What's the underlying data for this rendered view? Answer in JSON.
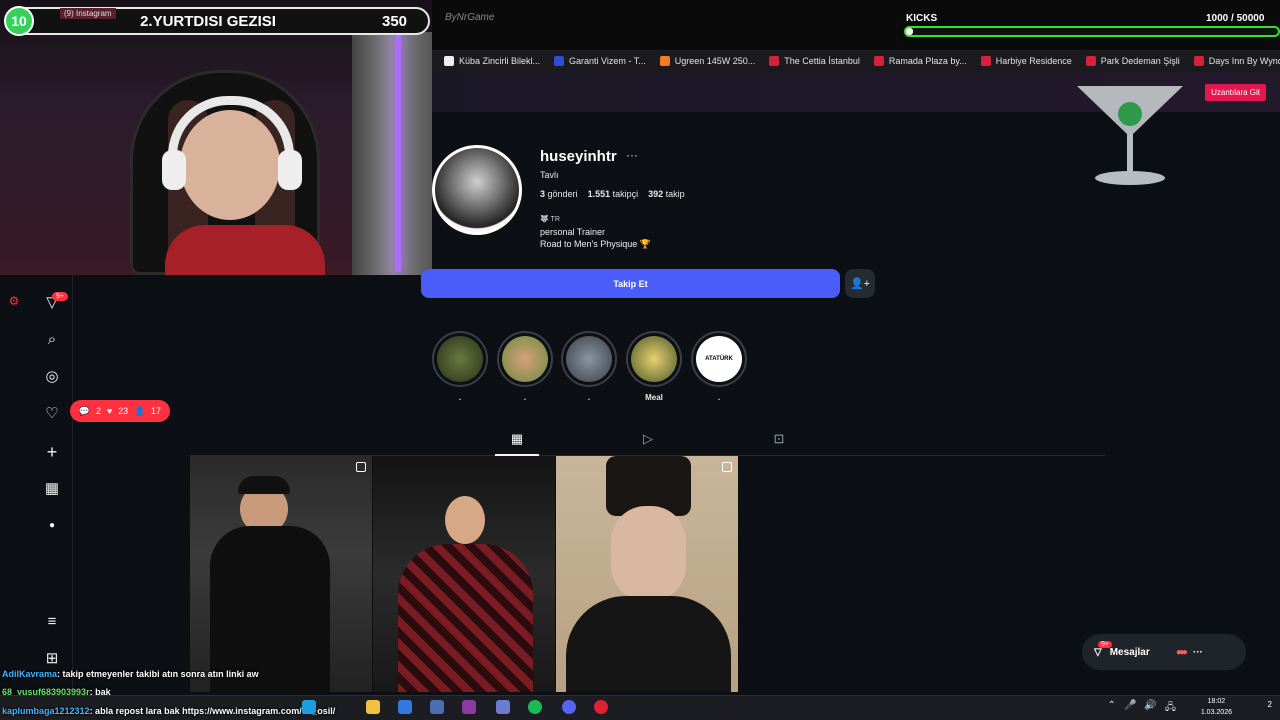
{
  "overlay": {
    "goal_count": "10",
    "goal_title": "2.YURTDISI GEZISI",
    "goal_value": "350",
    "tab_label": "(9) Instagram",
    "logo_mark": "ByNrGame",
    "kicks_title": "KICKS",
    "kicks_value": "1000  / 50000",
    "kicks_progress": 0.02
  },
  "bookmarks": [
    {
      "label": "Küba Zincirli Bilekl...",
      "color": "#f0f0f0"
    },
    {
      "label": "Garanti Vizem - T...",
      "color": "#2f4bd8"
    },
    {
      "label": "Ugreen 145W 250...",
      "color": "#f47b20"
    },
    {
      "label": "The Cettia İstanbul",
      "color": "#d6213a"
    },
    {
      "label": "Ramada Plaza by...",
      "color": "#d6213a"
    },
    {
      "label": "Harbiye Residence",
      "color": "#d6213a"
    },
    {
      "label": "Park Dedeman Şişli",
      "color": "#d6213a"
    },
    {
      "label": "Days Inn By Wynd...",
      "color": "#d6213a"
    }
  ],
  "extension_button": "Uzantılara Git",
  "sidebar": {
    "notif_badge": "9+",
    "activity": {
      "comments": "2",
      "likes": "23",
      "follows": "17"
    }
  },
  "profile": {
    "username": "huseyinhtr",
    "more": "···",
    "full_name": "Tavlı",
    "stats": {
      "posts_num": "3",
      "posts_label": "gönderi",
      "followers_num": "1.551",
      "followers_label": "takipçi",
      "following_num": "392",
      "following_label": "takip"
    },
    "bio_flag": "TR",
    "bio_line1": "personal Trainer",
    "bio_line2": "Road to Men's Physique 🏆",
    "follow_button": "Takip Et"
  },
  "highlights": [
    {
      "label": ".",
      "color": "#3a4a2a"
    },
    {
      "label": ".",
      "color": "#c58a5e"
    },
    {
      "label": ".",
      "color": "#5a6470"
    },
    {
      "label": "Meal",
      "color": "#8a7a40"
    },
    {
      "label": ".",
      "color": "#ffffff",
      "text": "ATATÜRK"
    }
  ],
  "messages": {
    "label": "Mesajlar",
    "badge": "9+"
  },
  "chat": [
    {
      "user": "AdilKavrama",
      "text": ": takip etmeyenler takibi atın sonra atın linki aw"
    },
    {
      "user": "68_yusuf683903993r",
      "text": ": bak"
    },
    {
      "user": "kaplumbaga1212312",
      "text": ": abla repost lara bak https://www.instagram.com/o6_osil/"
    }
  ],
  "taskbar": {
    "time": "18:02",
    "date": "1.03.2026",
    "notif": "2"
  }
}
